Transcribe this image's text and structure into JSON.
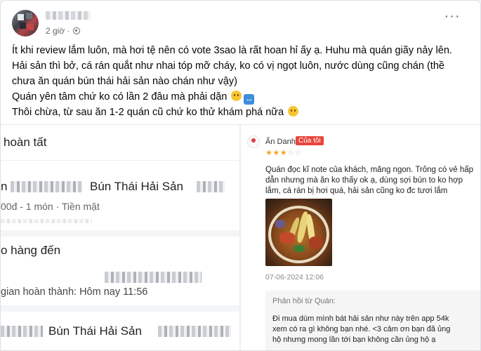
{
  "post": {
    "time": "2 giờ",
    "more_label": "···",
    "lines": [
      "Ít khi review lắm luôn, mà hơi tệ nên có vote 3sao là rất hoan hỉ ấy ạ. Huhu mà quán giãy nảy lên.",
      "Hải sản thì bở, cá rán quắt như nhai tóp mỡ cháy, ko có vị ngọt luôn, nước dùng cũng chán (thề",
      "chưa ăn quán bún thái hải sản nào chán như vậy)",
      "Quán yên tâm chứ ko có lần 2 đâu mà phải dặn",
      "Thôi chừa, từ sau ăn 1-2 quán cũ chứ ko thử khám phá nữa"
    ]
  },
  "order_screenshot": {
    "status": "hoàn tất",
    "shop_line1": "Bún Thái Hải Sản",
    "shop_line1_prefix": "n",
    "payment": "00đ - 1 món  ·  Tiền mặt",
    "delivered": "o hàng đến",
    "completed": "gian hoàn thành: Hôm nay 11:56",
    "shop_line2": "Bún Thái Hải Sản"
  },
  "review": {
    "author": "Ẩn Danh",
    "badge": "Của tôi",
    "rating": 3,
    "rating_max": 5,
    "comment": [
      "Quán đọc kĩ note của khách, măng ngon. Trông có vẻ hấp",
      "dẫn nhưng mà ăn ko thấy ok ạ, dùng sợi bún to ko hợp",
      "lắm, cá rán bị hơi quá, hải sản cũng ko đc tươi lắm"
    ],
    "date": "07-06-2024 12:06",
    "reply_title": "Phản hồi từ Quán:",
    "reply": [
      "Đi mua dùm mình bát hải sản như này trên app 54k",
      "xem có ra gì không bạn nhé. <3 cảm ơn bạn đã ủng",
      "hộ nhưng mong lần tới bạn không cần ủng hộ ạ"
    ]
  },
  "colors": {
    "text": "#050505",
    "meta": "#65676b",
    "star": "#f5a623",
    "badge": "#e8453c",
    "emoji": "#f7c531",
    "arrows_emoji": "#3f8ddc"
  },
  "icons": {
    "privacy": "globe-icon",
    "more": "more-options-icon",
    "emoji_smile": "smiling-face-emoji",
    "emoji_arrows": "left-right-arrow-emoji",
    "emoji_frown": "frowning-face-emoji"
  }
}
